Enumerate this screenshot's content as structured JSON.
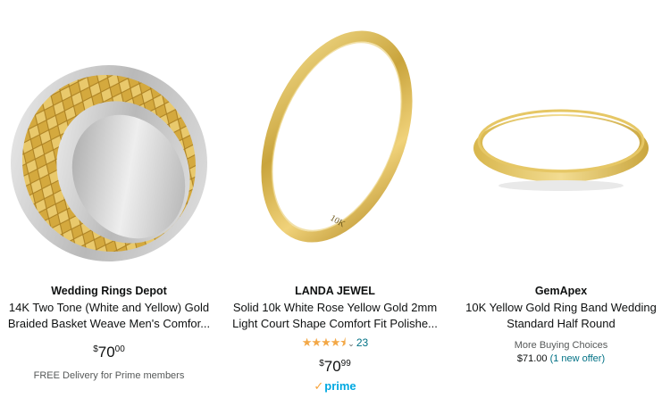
{
  "products": [
    {
      "brand": "Wedding Rings Depot",
      "title_line1": "14K Two Tone (White and Yellow) Gold",
      "title_line2": "Braided Basket Weave Men's Comfor...",
      "price_symbol": "$",
      "price_whole": "70",
      "price_fraction": "00",
      "delivery": "FREE Delivery for Prime members",
      "image_icon": "two-tone-braided-ring-image"
    },
    {
      "brand": "LANDA JEWEL",
      "title_line1": "Solid 10k White Rose Yellow Gold 2mm",
      "title_line2": "Light Court Shape Comfort Fit Polishe...",
      "rating_stars": "★★★★⯨",
      "rating_value": 4.5,
      "rating_count": "23",
      "price_symbol": "$",
      "price_whole": "70",
      "price_fraction": "99",
      "prime_label": "prime",
      "engraving": "10K",
      "image_icon": "thin-yellow-gold-band-image"
    },
    {
      "brand": "GemApex",
      "title_line1": "10K Yellow Gold Ring Band Wedding",
      "title_line2": "Standard Half Round",
      "more_choices": "More Buying Choices",
      "offer_price": "$71.00",
      "offer_link": "(1 new offer)",
      "image_icon": "half-round-gold-band-image"
    }
  ],
  "colors": {
    "image_bg": "#f3f3f3",
    "link": "#007185",
    "star": "#f3a847",
    "prime_blue": "#00a8e1",
    "gold": "#d9b54a"
  }
}
